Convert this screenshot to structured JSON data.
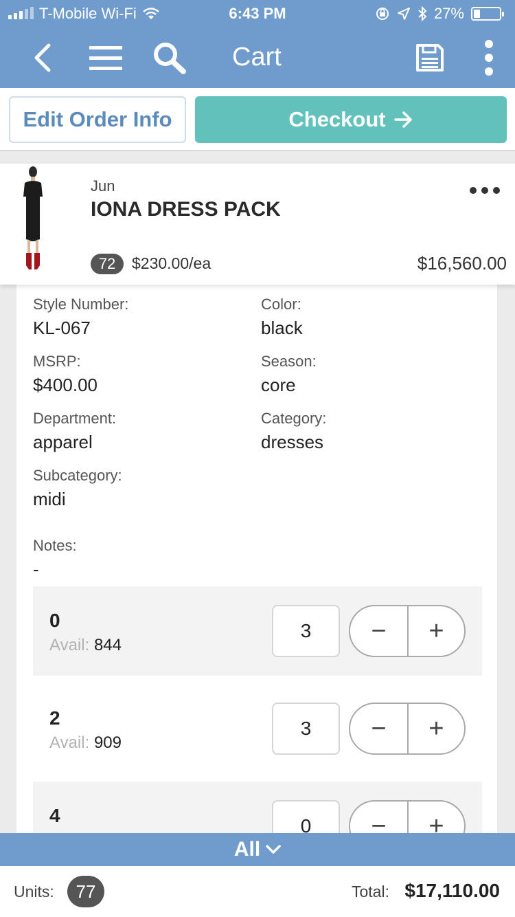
{
  "status_bar": {
    "carrier": "T-Mobile Wi-Fi",
    "time": "6:43 PM",
    "battery": "27%",
    "battery_level": 0.27,
    "icons": [
      "wifi-icon",
      "orientation-lock-icon",
      "location-icon",
      "bluetooth-icon",
      "battery-icon"
    ]
  },
  "navbar": {
    "title": "Cart",
    "icons": [
      "back-chevron-icon",
      "menu-icon",
      "search-icon",
      "save-icon",
      "more-vertical-icon"
    ]
  },
  "actions": {
    "edit_label": "Edit Order Info",
    "checkout_label": "Checkout",
    "checkout_icon": "arrow-right-icon"
  },
  "product": {
    "vendor": "Jun",
    "name": "IONA DRESS PACK",
    "quantity": "72",
    "unit_price": "$230.00/ea",
    "line_total": "$16,560.00"
  },
  "details": {
    "style_number": {
      "label": "Style Number:",
      "value": "KL-067"
    },
    "color": {
      "label": "Color:",
      "value": "black"
    },
    "msrp": {
      "label": "MSRP:",
      "value": "$400.00"
    },
    "season": {
      "label": "Season:",
      "value": "core"
    },
    "department": {
      "label": "Department:",
      "value": "apparel"
    },
    "category": {
      "label": "Category:",
      "value": "dresses"
    },
    "subcategory": {
      "label": "Subcategory:",
      "value": "midi"
    },
    "notes": {
      "label": "Notes:",
      "value": "-"
    }
  },
  "sizes": [
    {
      "size": "0",
      "avail_label": "Avail:",
      "avail": "844",
      "qty": "3",
      "minus": "−",
      "plus": "+"
    },
    {
      "size": "2",
      "avail_label": "Avail:",
      "avail": "909",
      "qty": "3",
      "minus": "−",
      "plus": "+"
    },
    {
      "size": "4",
      "avail_label": "",
      "avail": "",
      "qty": "0",
      "minus": "−",
      "plus": "+"
    }
  ],
  "filter": {
    "label": "All",
    "icon": "chevron-down-icon"
  },
  "footer": {
    "units_label": "Units:",
    "units_value": "77",
    "total_label": "Total:",
    "total_value": "$17,110.00"
  },
  "colors": {
    "header_blue": "#6f9ccc",
    "checkout_teal": "#62c2bb",
    "edit_text_blue": "#5b8bbd",
    "badge_gray": "#555555"
  }
}
